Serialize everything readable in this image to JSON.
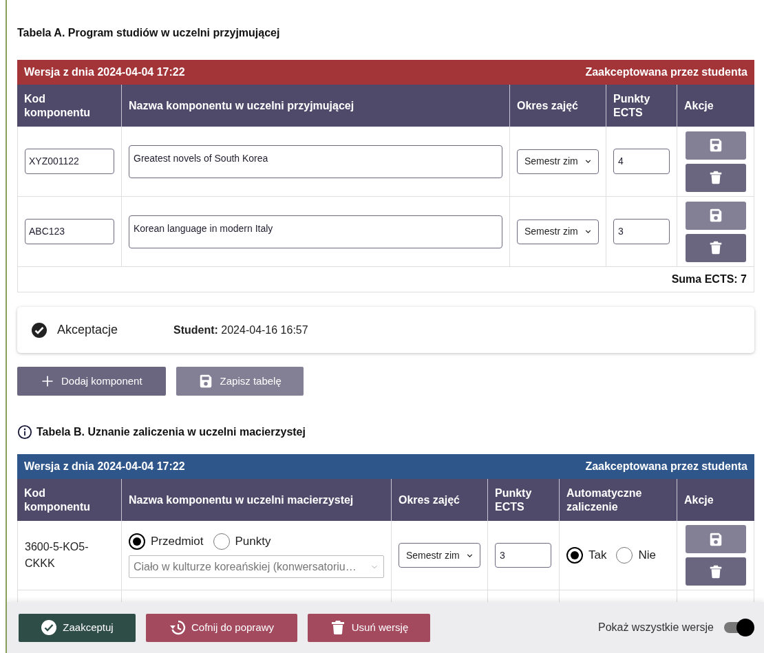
{
  "table_a": {
    "title": "Tabela A. Program studiów w uczelni przyjmującej",
    "version": "Wersja z dnia 2024-04-04 17:22",
    "status": "Zaakceptowana przez studenta",
    "columns": [
      "Kod komponentu",
      "Nazwa komponentu w uczelni przyjmującej",
      "Okres zajęć",
      "Punkty ECTS",
      "Akcje"
    ],
    "rows": [
      {
        "code": "XYZ001122",
        "name": "Greatest novels of South Korea",
        "period": "Semestr zim",
        "ects": "4",
        "save_disabled": true
      },
      {
        "code": "ABC123",
        "name": "Korean language in modern Italy",
        "period": "Semestr zim",
        "ects": "3",
        "save_disabled": true
      }
    ],
    "sum": "Suma ECTS: 7"
  },
  "acceptances": {
    "title": "Akceptacje",
    "entries": [
      {
        "label": "Student:",
        "value": "2024-04-16 16:57"
      }
    ]
  },
  "buttons": [
    {
      "label": "Dodaj komponent",
      "kind": "add",
      "disabled": false
    },
    {
      "label": "Zapisz tabelę",
      "kind": "save",
      "disabled": true
    }
  ],
  "table_b": {
    "title": "Tabela B. Uznanie zaliczenia w uczelni macierzystej",
    "version": "Wersja z dnia 2024-04-04 17:22",
    "status": "Zaakceptowana przez studenta",
    "columns": [
      "Kod komponentu",
      "Nazwa komponentu w uczelni macierzystej",
      "Okres zajęć",
      "Punkty ECTS",
      "Automatyczne zaliczenie",
      "Akcje"
    ],
    "rows": [
      {
        "code": "3600-5-KO5-CKKK",
        "type_options": [
          {
            "label": "Przedmiot",
            "selected": true
          },
          {
            "label": "Punkty",
            "selected": false
          }
        ],
        "course": "Ciało w kulturze koreańskiej (konwersatoriu…",
        "period": "Semestr zim",
        "ects": "3",
        "auto_options": [
          {
            "label": "Tak",
            "selected": true
          },
          {
            "label": "Nie",
            "selected": false
          }
        ],
        "save_disabled": true
      }
    ]
  },
  "footer": {
    "buttons": [
      {
        "label": "Zaakceptuj",
        "kind": "accept"
      },
      {
        "label": "Cofnij do poprawy",
        "kind": "revert"
      },
      {
        "label": "Usuń wersję",
        "kind": "delete"
      }
    ],
    "toggle": {
      "label": "Pokaż wszystkie wersje",
      "on": true
    }
  }
}
